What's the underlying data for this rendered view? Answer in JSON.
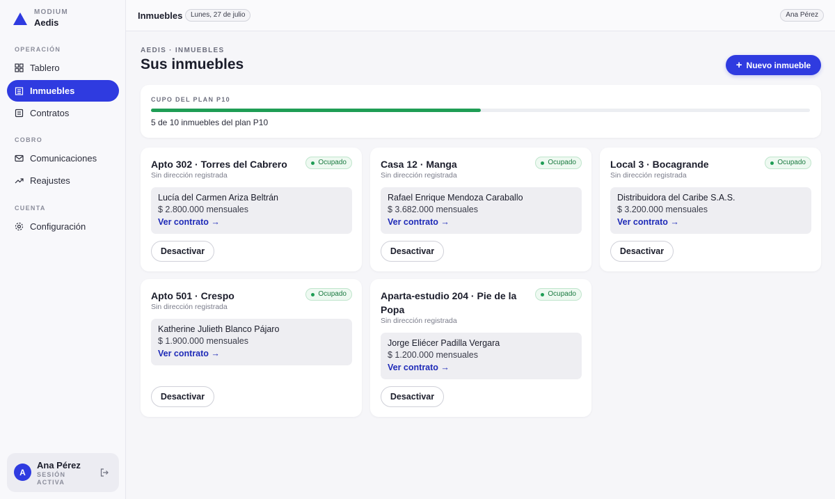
{
  "brand": {
    "sub": "MODIUM",
    "name": "Aedis"
  },
  "sidebar": {
    "sections": [
      {
        "label": "OPERACIÓN"
      },
      {
        "label": "COBRO"
      },
      {
        "label": "CUENTA"
      }
    ],
    "items": [
      {
        "label": "Tablero",
        "icon": "grid-icon"
      },
      {
        "label": "Inmuebles",
        "icon": "building-icon",
        "active": true
      },
      {
        "label": "Contratos",
        "icon": "document-icon"
      },
      {
        "label": "Comunicaciones",
        "icon": "mail-icon"
      },
      {
        "label": "Reajustes",
        "icon": "trend-up-icon"
      },
      {
        "label": "Configuración",
        "icon": "gear-icon"
      }
    ]
  },
  "user": {
    "initial": "A",
    "name": "Ana Pérez",
    "status": "SESIÓN ACTIVA"
  },
  "topbar": {
    "title": "Inmuebles",
    "date": "Lunes, 27 de julio",
    "user": "Ana Pérez"
  },
  "header": {
    "breadcrumb": "AEDIS · INMUEBLES",
    "title": "Sus inmuebles",
    "new_button": "Nuevo inmueble"
  },
  "plan": {
    "label": "CUPO DEL PLAN P10",
    "used": 5,
    "total": 10,
    "progress": 0.5,
    "text": "5 de 10 inmuebles del plan P10"
  },
  "properties": [
    {
      "title": "Apto 302 · Torres del Cabrero",
      "address": "Sin dirección registrada",
      "status": "Ocupado",
      "tenant": "Lucía del Carmen Ariza Beltrán",
      "rent": "$ 2.800.000 mensuales",
      "link": "Ver contrato →",
      "action": "Desactivar"
    },
    {
      "title": "Casa 12 · Manga",
      "address": "Sin dirección registrada",
      "status": "Ocupado",
      "tenant": "Rafael Enrique Mendoza Caraballo",
      "rent": "$ 3.682.000 mensuales",
      "link": "Ver contrato →",
      "action": "Desactivar"
    },
    {
      "title": "Local 3 · Bocagrande",
      "address": "Sin dirección registrada",
      "status": "Ocupado",
      "tenant": "Distribuidora del Caribe S.A.S.",
      "rent": "$ 3.200.000 mensuales",
      "link": "Ver contrato →",
      "action": "Desactivar"
    },
    {
      "title": "Apto 501 · Crespo",
      "address": "Sin dirección registrada",
      "status": "Ocupado",
      "tenant": "Katherine Julieth Blanco Pájaro",
      "rent": "$ 1.900.000 mensuales",
      "link": "Ver contrato →",
      "action": "Desactivar"
    },
    {
      "title": "Aparta-estudio 204 · Pie de la Popa",
      "address": "Sin dirección registrada",
      "status": "Ocupado",
      "tenant": "Jorge Eliécer Padilla Vergara",
      "rent": "$ 1.200.000 mensuales",
      "link": "Ver contrato →",
      "action": "Desactivar"
    }
  ],
  "colors": {
    "accent": "#2f3be0",
    "success": "#1f9d55",
    "link": "#1f2bb8"
  }
}
